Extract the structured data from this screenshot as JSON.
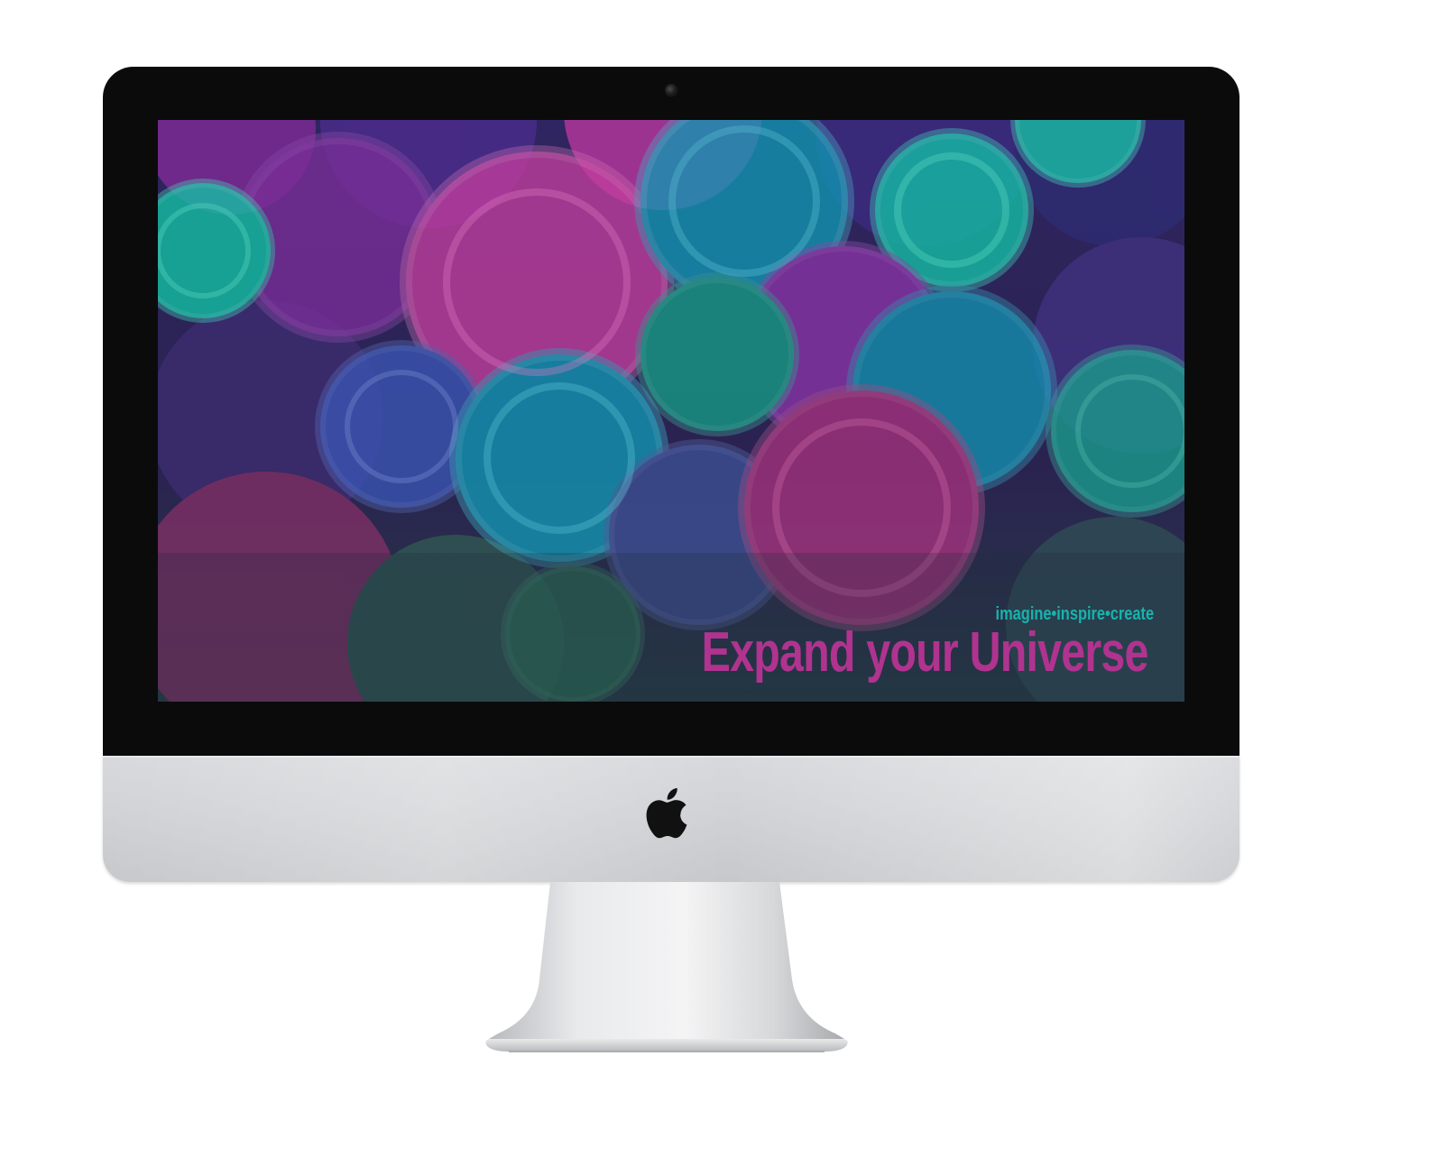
{
  "wallpaper": {
    "tagline": "imagine•inspire•create",
    "headline": "Expand your Universe",
    "colors": {
      "tagline": "#17b3ad",
      "headline": "#b0338f",
      "background": "#2a2150"
    }
  },
  "device": {
    "logo_icon": "apple-logo-icon",
    "bezel_color": "#0b0b0c",
    "body_color": "#d2d3d6"
  }
}
